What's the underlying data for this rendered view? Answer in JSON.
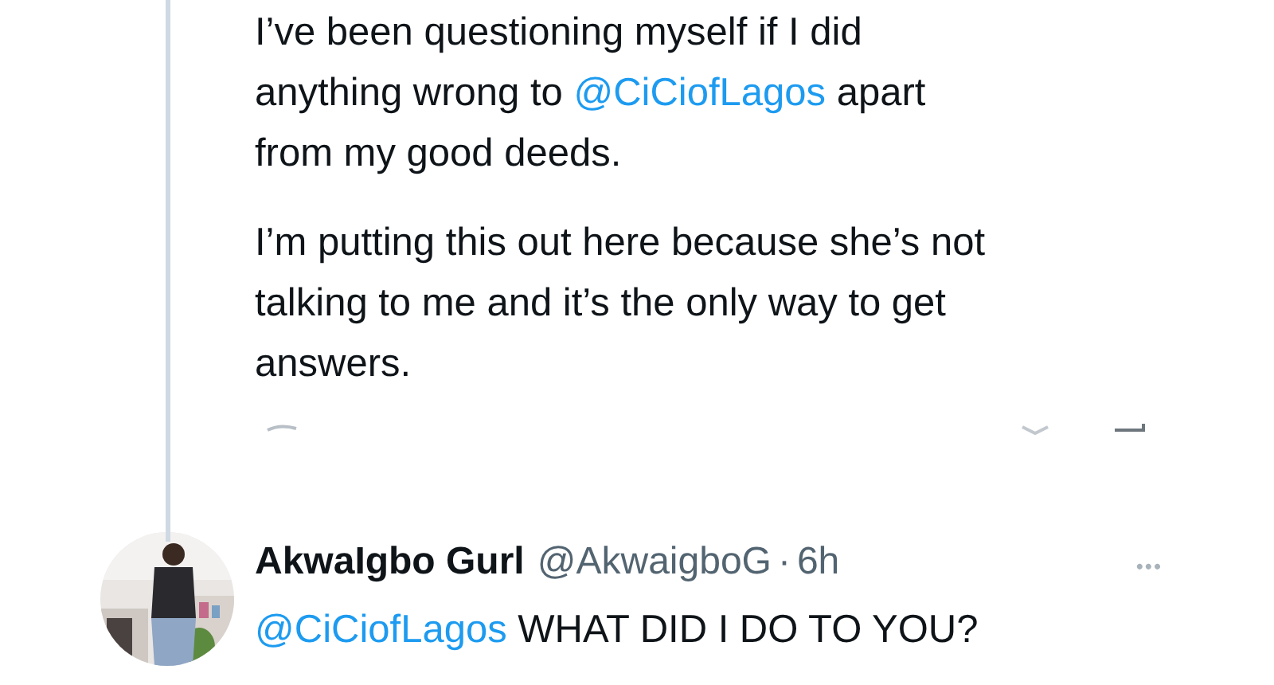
{
  "tweet": {
    "paragraphs": [
      {
        "lines": [
          [
            {
              "kind": "text",
              "text": "I’ve been questioning myself if I did"
            }
          ],
          [
            {
              "kind": "text",
              "text": "anything wrong to "
            },
            {
              "kind": "mention",
              "text": "@CiCiofLagos"
            },
            {
              "kind": "text",
              "text": " apart"
            }
          ],
          [
            {
              "kind": "text",
              "text": "from my good deeds."
            }
          ]
        ]
      },
      {
        "lines": [
          [
            {
              "kind": "text",
              "text": "I’m putting this out here because she’s not"
            }
          ],
          [
            {
              "kind": "text",
              "text": "talking to me and it’s the only way to get"
            }
          ],
          [
            {
              "kind": "text",
              "text": "answers."
            }
          ]
        ]
      }
    ]
  },
  "reply": {
    "avatar": {
      "kind": "picture"
    },
    "name": "AkwaIgbo Gurl",
    "handle": "@AkwaigboG",
    "separator": "·",
    "time": "6h",
    "more": "•••",
    "lines": [
      [
        {
          "kind": "mention",
          "text": "@CiCiofLagos"
        },
        {
          "kind": "text",
          "text": " WHAT DID I DO TO YOU?"
        }
      ]
    ]
  }
}
